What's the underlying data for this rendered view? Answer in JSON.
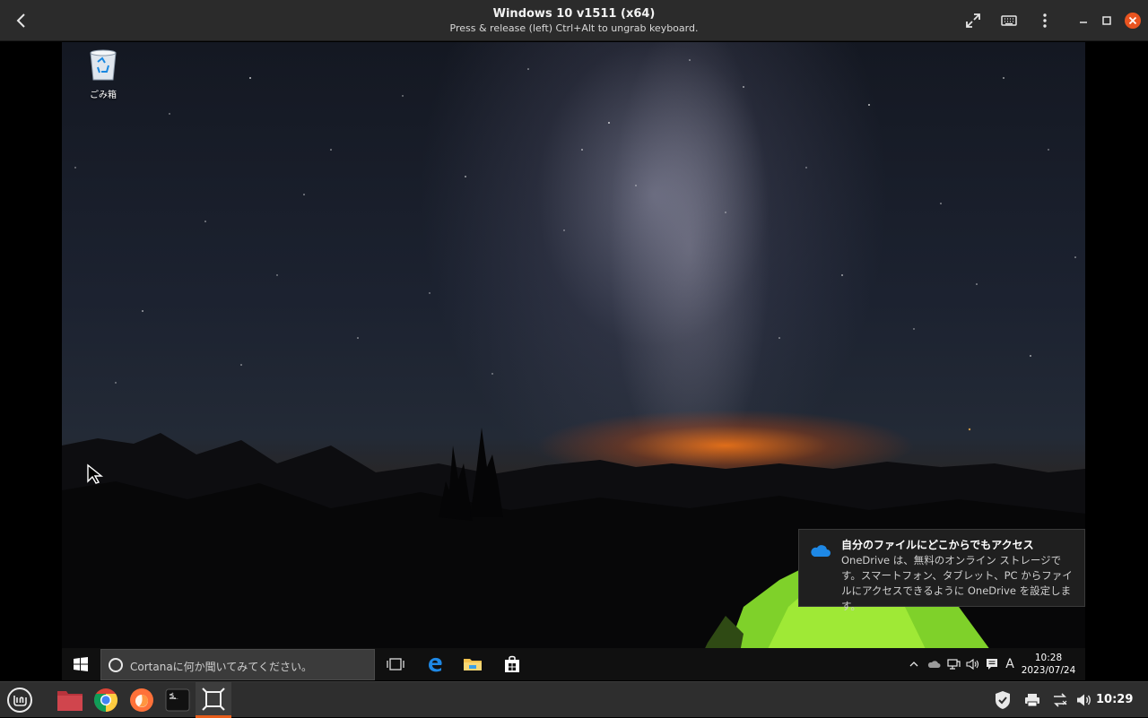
{
  "window": {
    "title": "Windows 10 v1511 (x64)",
    "subtitle": "Press & release (left) Ctrl+Alt to ungrab keyboard.",
    "icons": [
      "back-icon",
      "fullscreen-icon",
      "keyboard-icon",
      "menu-icon",
      "minimize-icon",
      "maximize-icon",
      "close-icon"
    ]
  },
  "desktop": {
    "recycle_bin_label": "ごみ箱"
  },
  "notification": {
    "title": "自分のファイルにどこからでもアクセス",
    "body": "OneDrive は、無料のオンライン ストレージです。スマートフォン、タブレット、PC からファイルにアクセスできるように OneDrive を設定します。",
    "icon": "onedrive-cloud-icon"
  },
  "win_taskbar": {
    "search_placeholder": "Cortanaに何か聞いてみてください。",
    "apps": [
      "task-view-icon",
      "edge-icon",
      "file-explorer-icon",
      "store-icon"
    ],
    "tray": {
      "ime": "A",
      "time": "10:28",
      "date": "2023/07/24"
    }
  },
  "host_panel": {
    "launchers": [
      "mint-menu-icon",
      "files-icon",
      "chrome-icon",
      "firefox-icon",
      "terminal-icon",
      "boxes-icon"
    ],
    "clock": "10:29"
  },
  "colors": {
    "accent_active": "#e85d1a",
    "close_button": "#e95420",
    "win_blue": "#1e88e5"
  }
}
